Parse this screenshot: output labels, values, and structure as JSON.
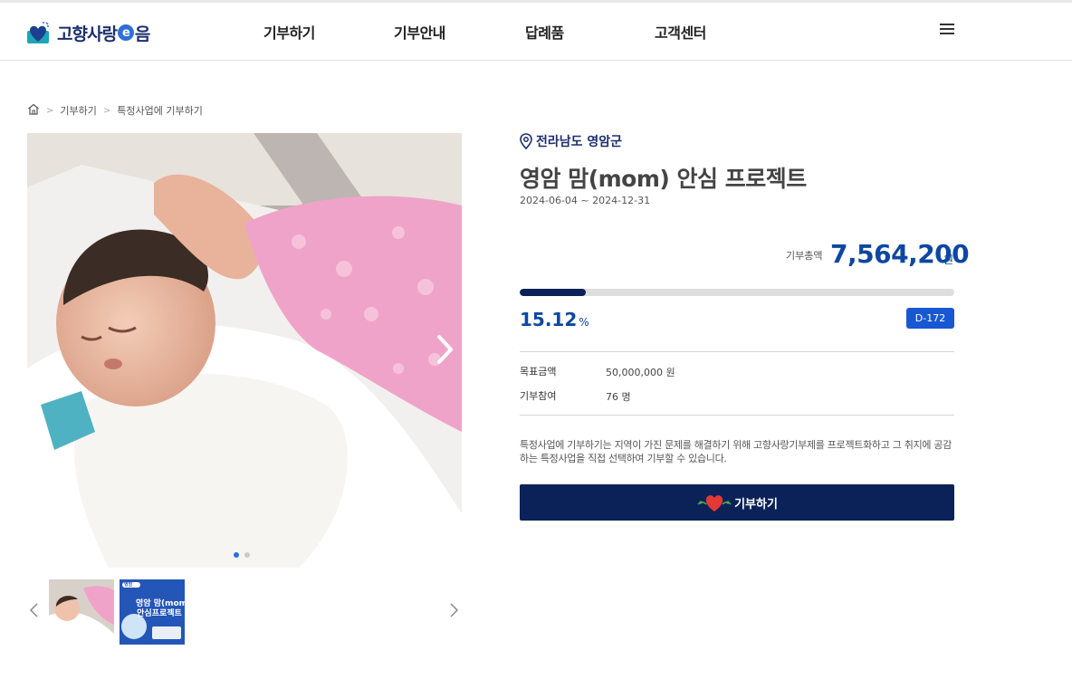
{
  "header": {
    "logo_text_1": "고향사랑",
    "logo_e": "e",
    "logo_text_2": "음",
    "nav": [
      "기부하기",
      "기부안내",
      "답례품",
      "고객센터"
    ]
  },
  "breadcrumb": {
    "items": [
      "기부하기",
      "특정사업에 기부하기"
    ]
  },
  "project": {
    "region": "전라남도 영암군",
    "title": "영암 맘(mom) 안심 프로젝트",
    "period": "2024-06-04 ~ 2024-12-31",
    "total_label": "기부총액",
    "total_value": "7,564,200",
    "total_unit": "원",
    "progress_fraction": 0.1512,
    "percent_value": "15.12",
    "percent_sign": "%",
    "dday": "D-172",
    "goal_label": "목표금액",
    "goal_value": "50,000,000 원",
    "participants_label": "기부참여",
    "participants_value": "76 명",
    "description": "특정사업에 기부하기는 지역이 가진 문제를 해결하기 위해 고향사랑기부제를 프로젝트화하고 그 취지에 공감하는 특정사업을 직접 선택하여 기부할 수 있습니다.",
    "donate_label": "기부하기"
  },
  "gallery": {
    "slide_count": 2,
    "active_slide": 1,
    "poster": {
      "badge": "영암",
      "line1": "영암 맘(mom)",
      "line2": "안심프로젝트"
    }
  },
  "colors": {
    "navy": "#0b2259",
    "brand_blue": "#0d47a1",
    "badge_blue": "#1857d4"
  },
  "icons": {
    "home": "home-icon",
    "location": "location-pin-icon",
    "menu": "hamburger-icon",
    "heart": "heart-icon"
  }
}
